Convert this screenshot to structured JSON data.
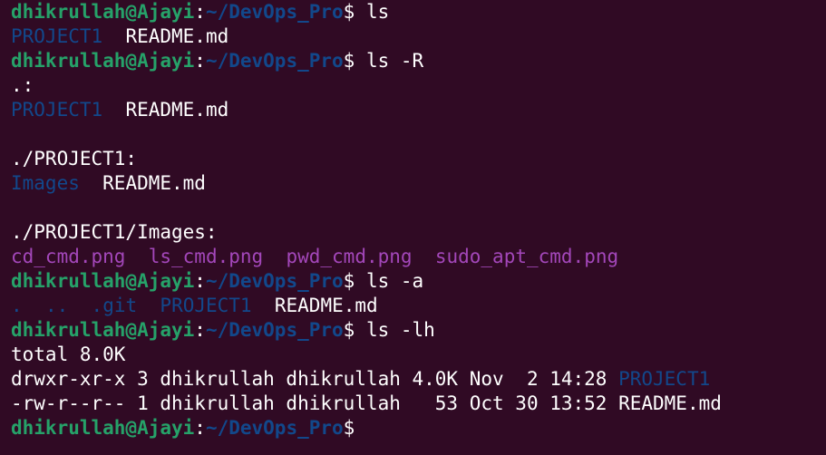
{
  "prompt": {
    "user_host": "dhikrullah@Ajayi",
    "sep": ":",
    "path": "~/DevOps_Pro",
    "symbol": "$"
  },
  "colors": {
    "background": "#300a24",
    "user": "#26a269",
    "directory": "#12488b",
    "image_file": "#a347ba",
    "text": "#ffffff"
  },
  "session": {
    "cmd1": " ls",
    "out1": {
      "d1": "PROJECT1",
      "sp": "  ",
      "f1": "README.md"
    },
    "cmd2": " ls -R",
    "out2a": ".:",
    "out2b": {
      "d1": "PROJECT1",
      "sp": "  ",
      "f1": "README.md"
    },
    "out2c": "./PROJECT1:",
    "out2d": {
      "d1": "Images",
      "sp": "  ",
      "f1": "README.md"
    },
    "out2e": "./PROJECT1/Images:",
    "out2f": {
      "i1": "cd_cmd.png",
      "sp1": "  ",
      "i2": "ls_cmd.png",
      "sp2": "  ",
      "i3": "pwd_cmd.png",
      "sp3": "  ",
      "i4": "sudo_apt_cmd.png"
    },
    "cmd3": " ls -a",
    "out3": {
      "d1": ".",
      "sp1": "  ",
      "d2": "..",
      "sp2": "  ",
      "d3": ".git",
      "sp3": "  ",
      "d4": "PROJECT1",
      "sp4": "  ",
      "f1": "README.md"
    },
    "cmd4": " ls -lh",
    "out4a": "total 8.0K",
    "out4b": {
      "meta": "drwxr-xr-x 3 dhikrullah dhikrullah 4.0K Nov  2 14:28 ",
      "d1": "PROJECT1"
    },
    "out4c": "-rw-r--r-- 1 dhikrullah dhikrullah   53 Oct 30 13:52 README.md"
  }
}
